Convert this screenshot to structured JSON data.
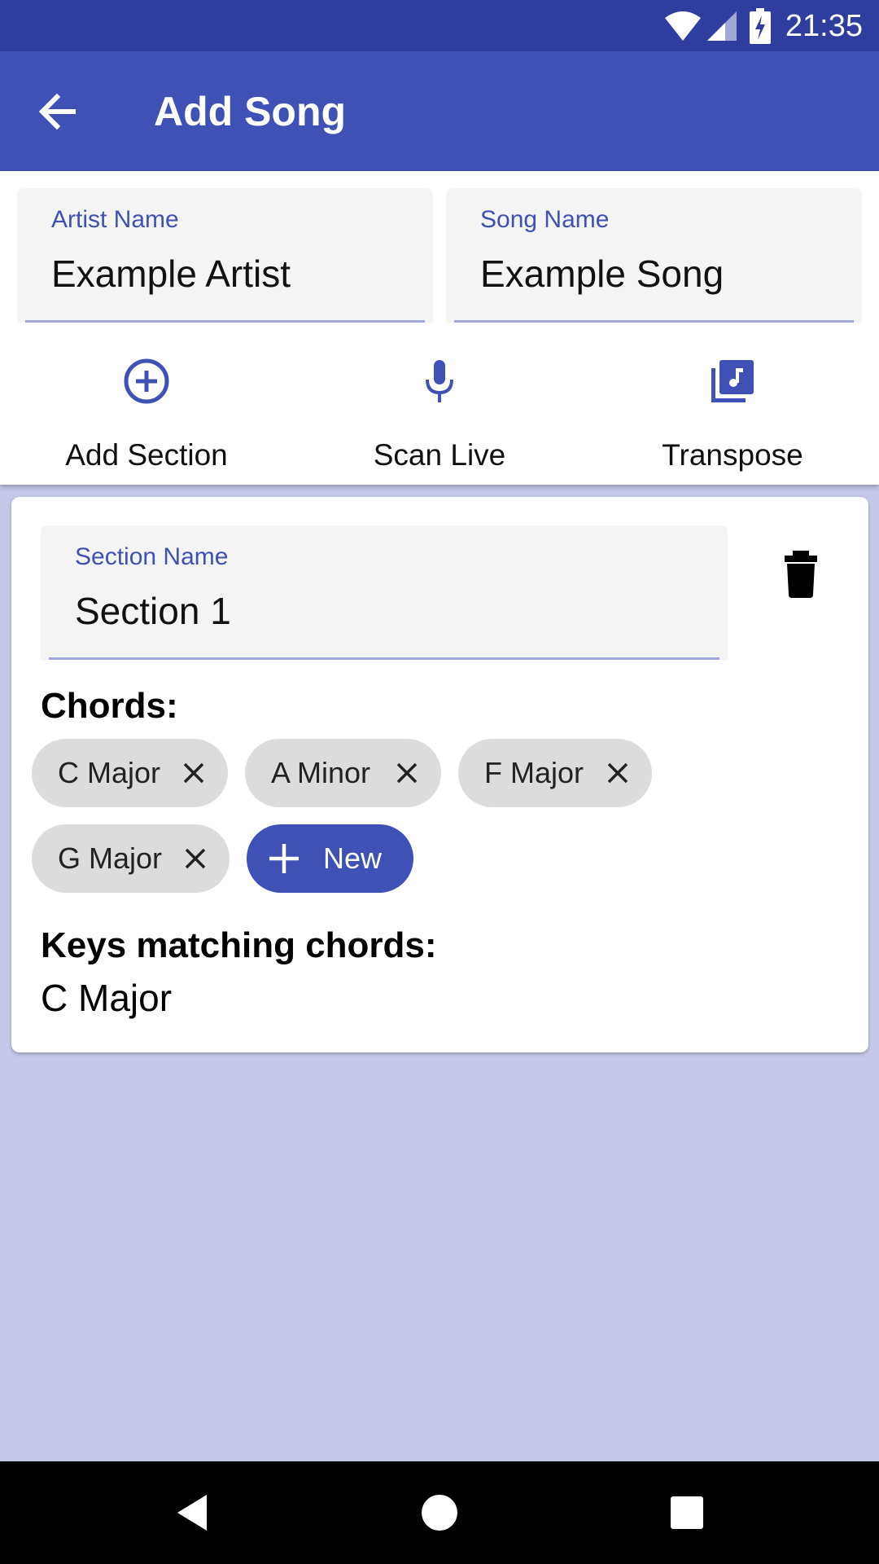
{
  "status_bar": {
    "time": "21:35",
    "icons": [
      "wifi-icon",
      "signal-icon",
      "battery-charging-icon"
    ]
  },
  "app_bar": {
    "title": "Add Song",
    "back_icon": "arrow-back-icon"
  },
  "fields": {
    "artist": {
      "label": "Artist Name",
      "value": "Example Artist"
    },
    "song": {
      "label": "Song Name",
      "value": "Example Song"
    }
  },
  "actions": [
    {
      "label": "Add Section",
      "icon": "add-circle-icon"
    },
    {
      "label": "Scan Live",
      "icon": "microphone-icon"
    },
    {
      "label": "Transpose",
      "icon": "music-library-icon"
    }
  ],
  "section": {
    "name_label": "Section Name",
    "name_value": "Section 1",
    "delete_icon": "trash-icon",
    "chords_heading": "Chords:",
    "chords": [
      "C Major",
      "A Minor",
      "F Major",
      "G Major"
    ],
    "new_chip_label": "New",
    "keys_heading": "Keys matching chords:",
    "keys_value": "C Major"
  },
  "colors": {
    "primary": "#3f51b5",
    "primary_dark": "#2f3e9e",
    "background": "#c5c8e8",
    "chip": "#dcdcdc"
  },
  "nav_bar": {
    "icons": [
      "back-triangle-icon",
      "home-circle-icon",
      "recents-square-icon"
    ]
  }
}
